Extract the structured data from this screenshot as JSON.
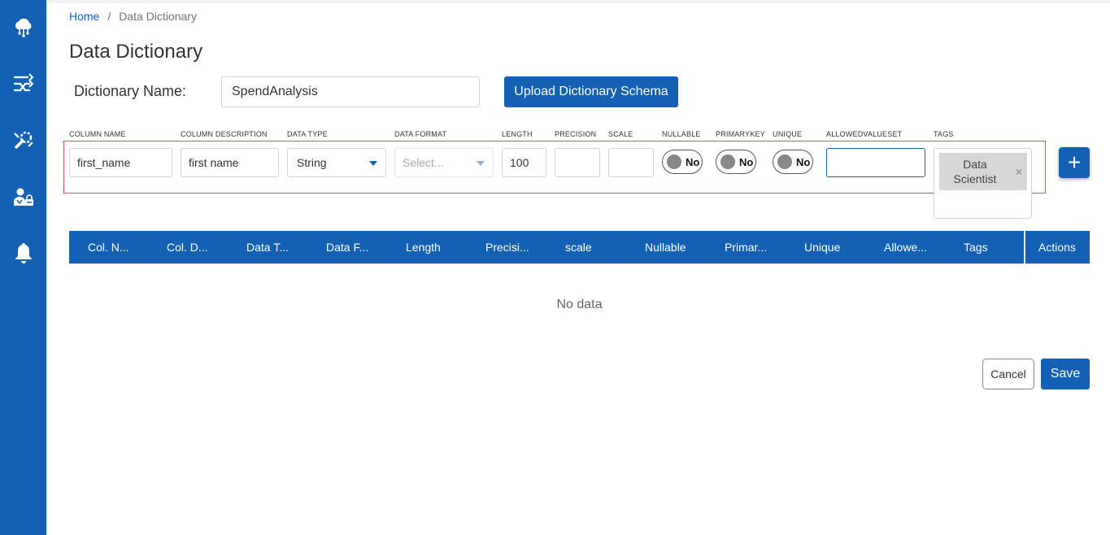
{
  "sidebar": {
    "icons": [
      "cloud-icon",
      "shuffle-icon",
      "tools-icon",
      "user-lock-icon",
      "bell-icon"
    ]
  },
  "breadcrumb": {
    "home": "Home",
    "separator": "/",
    "current": "Data Dictionary"
  },
  "page": {
    "title": "Data Dictionary"
  },
  "dictionary": {
    "label": "Dictionary Name:",
    "name_value": "SpendAnalysis",
    "upload_label": "Upload Dictionary Schema"
  },
  "form": {
    "labels": {
      "column_name": "COLUMN NAME",
      "column_description": "COLUMN DESCRIPTION",
      "data_type": "DATA TYPE",
      "data_format": "DATA FORMAT",
      "length": "LENGTH",
      "precision": "PRECISION",
      "scale": "SCALE",
      "nullable": "NULLABLE",
      "primarykey": "PRIMARYKEY",
      "unique": "UNIQUE",
      "allowedvalueset": "ALLOWEDVALUESET",
      "tags": "TAGS"
    },
    "values": {
      "column_name": "first_name",
      "column_description": "first name",
      "data_type": "String",
      "data_format_placeholder": "Select...",
      "length": "100",
      "precision": "",
      "scale": "",
      "allowedvalueset": ""
    },
    "toggles": {
      "nullable": "No",
      "primarykey": "No",
      "unique": "No"
    },
    "tags": [
      {
        "label": "Data Scientist",
        "remove": "×"
      }
    ],
    "add_label": "+"
  },
  "table": {
    "headers": [
      "Col. N...",
      "Col. D...",
      "Data T...",
      "Data F...",
      "Length",
      "Precisi...",
      "scale",
      "Nullable",
      "Primar...",
      "Unique",
      "Allowe...",
      "Tags",
      "Actions"
    ],
    "empty_text": "No data"
  },
  "actions": {
    "cancel": "Cancel",
    "save": "Save"
  },
  "colors": {
    "primary": "#1460b4",
    "highlight_border": "#e05050"
  }
}
